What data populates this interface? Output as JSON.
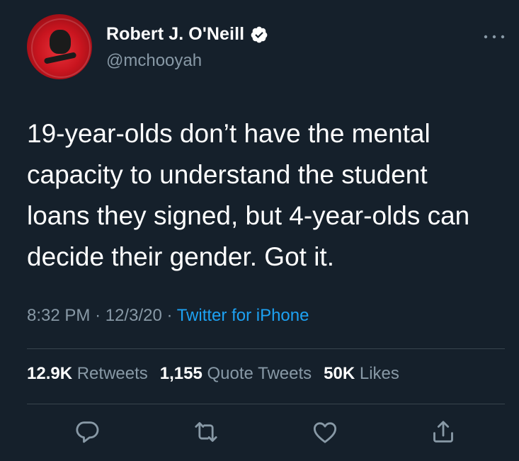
{
  "user": {
    "display_name": "Robert J. O'Neill",
    "handle": "@mchooyah",
    "verified": true
  },
  "tweet": {
    "text": "19-year-olds don’t have the mental\ncapacity to understand the student\nloans they signed, but 4-year-olds can\ndecide their gender. Got it.",
    "time": "8:32 PM",
    "separator": "·",
    "date": "12/3/20",
    "source": "Twitter for iPhone"
  },
  "stats": {
    "retweets_count": "12.9K",
    "retweets_label": "Retweets",
    "quotes_count": "1,155",
    "quotes_label": "Quote Tweets",
    "likes_count": "50K",
    "likes_label": "Likes"
  },
  "icons": {
    "more": "more-options-icon",
    "reply": "reply-icon",
    "retweet": "retweet-icon",
    "like": "heart-icon",
    "share": "share-icon",
    "verified": "verified-badge-icon"
  },
  "colors": {
    "background": "#15202b",
    "primary_text": "#ffffff",
    "secondary_text": "#8899a6",
    "accent": "#1da1f2",
    "divider": "#38444d"
  }
}
